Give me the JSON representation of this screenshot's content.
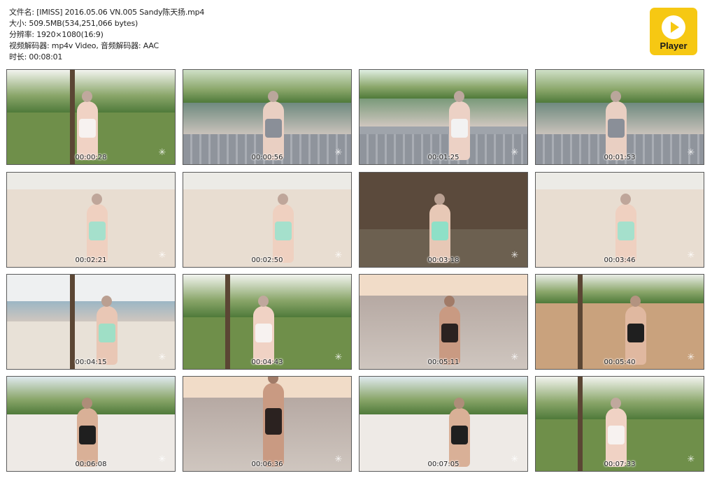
{
  "file_info": {
    "filename": "文件名: [IMISS] 2016.05.06 VN.005 Sandy陈天扬.mp4",
    "size": "大小: 509.5MB(534,251,066 bytes)",
    "resolution": "分辨率: 1920×1080(16:9)",
    "codecs": "视频解码器: mp4v Video, 音频解码器: AAC",
    "duration": "时长: 00:08:01"
  },
  "player_button": {
    "label": "Player",
    "icon": "play-circle-icon",
    "color": "#f6c813"
  },
  "thumbnails": [
    {
      "time": "00:00:28",
      "scene": "garden"
    },
    {
      "time": "00:00:56",
      "scene": "pool"
    },
    {
      "time": "00:01:25",
      "scene": "deck"
    },
    {
      "time": "00:01:53",
      "scene": "pool"
    },
    {
      "time": "00:02:21",
      "scene": "beach"
    },
    {
      "time": "00:02:50",
      "scene": "beach"
    },
    {
      "time": "00:03:18",
      "scene": "hut"
    },
    {
      "time": "00:03:46",
      "scene": "beach"
    },
    {
      "time": "00:04:15",
      "scene": "sea"
    },
    {
      "time": "00:04:43",
      "scene": "garden"
    },
    {
      "time": "00:05:11",
      "scene": "sunset"
    },
    {
      "time": "00:05:40",
      "scene": "tree"
    },
    {
      "time": "00:06:08",
      "scene": "palms"
    },
    {
      "time": "00:06:36",
      "scene": "sunset"
    },
    {
      "time": "00:07:05",
      "scene": "palms"
    },
    {
      "time": "00:07:33",
      "scene": "garden"
    }
  ]
}
